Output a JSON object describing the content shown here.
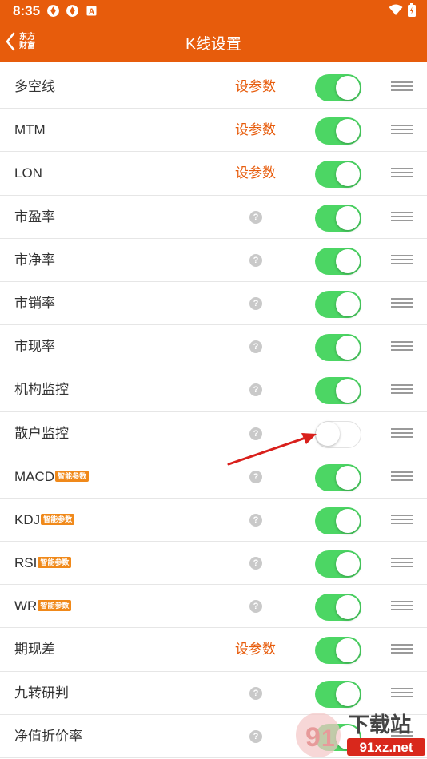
{
  "status": {
    "time": "8:35"
  },
  "header": {
    "title": "K线设置",
    "logo_line1": "东方",
    "logo_line2": "财富"
  },
  "rows": [
    {
      "label": "多空线",
      "badge": "",
      "param": "设参数",
      "on": true
    },
    {
      "label": "MTM",
      "badge": "",
      "param": "设参数",
      "on": true
    },
    {
      "label": "LON",
      "badge": "",
      "param": "设参数",
      "on": true
    },
    {
      "label": "市盈率",
      "badge": "",
      "param": "",
      "on": true
    },
    {
      "label": "市净率",
      "badge": "",
      "param": "",
      "on": true
    },
    {
      "label": "市销率",
      "badge": "",
      "param": "",
      "on": true
    },
    {
      "label": "市现率",
      "badge": "",
      "param": "",
      "on": true
    },
    {
      "label": "机构监控",
      "badge": "",
      "param": "",
      "on": true
    },
    {
      "label": "散户监控",
      "badge": "",
      "param": "",
      "on": false
    },
    {
      "label": "MACD",
      "badge": "智能参数",
      "param": "",
      "on": true
    },
    {
      "label": "KDJ",
      "badge": "智能参数",
      "param": "",
      "on": true
    },
    {
      "label": "RSI",
      "badge": "智能参数",
      "param": "",
      "on": true
    },
    {
      "label": "WR",
      "badge": "智能参数",
      "param": "",
      "on": true
    },
    {
      "label": "期现差",
      "badge": "",
      "param": "设参数",
      "on": true
    },
    {
      "label": "九转研判",
      "badge": "",
      "param": "",
      "on": true
    },
    {
      "label": "净值折价率",
      "badge": "",
      "param": "",
      "on": true
    }
  ],
  "help_glyph": "?",
  "watermark": {
    "text1": "下载站",
    "text2": "91xz.net"
  },
  "colors": {
    "brand": "#e75c0c",
    "toggle_on": "#4cd664"
  }
}
